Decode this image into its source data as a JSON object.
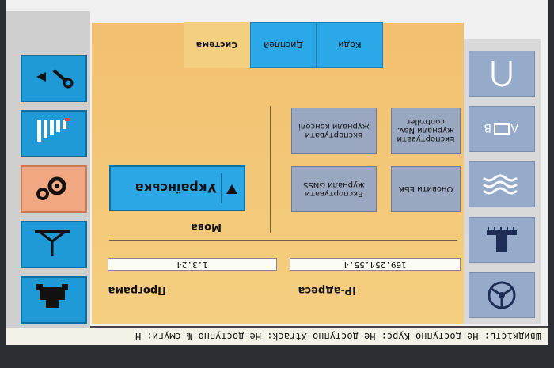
{
  "status_bar": {
    "text": "Швидкість: Не доступно   Курс: Не доступно   Xtrack: Не доступно   № смуги: Н"
  },
  "system": {
    "program_label": "Програма",
    "program_version": "1.3.24",
    "ip_label": "IP-адреса",
    "ip_value": "169.254.55.4",
    "language_label": "Мова",
    "language_value": "Українська"
  },
  "buttons": {
    "export_gnss": "Експортувати журнали GNSS",
    "export_console": "Експортувати журнали консолі",
    "update_ebk": "Оновити ЕБК",
    "export_nav": "Експортувати журнали Nav. controller"
  },
  "tabs": [
    {
      "label": "Система",
      "active": true
    },
    {
      "label": "Дисплей",
      "active": false
    },
    {
      "label": "Коди",
      "active": false
    }
  ],
  "left_buttons": [
    "steering-wheel-icon",
    "implement-icon",
    "wave-icon",
    "a-b-line-icon",
    "loop-icon"
  ],
  "right_buttons": [
    "tractor-icon",
    "implement-width-icon",
    "settings-gears-icon",
    "signal-bars-icon",
    "wrench-icon"
  ],
  "colors": {
    "accent_blue": "#2aa7e4",
    "panel_orange": "#f4cf7f",
    "active_tab": "#f4cf7f",
    "settings_active": "#f1a782"
  }
}
